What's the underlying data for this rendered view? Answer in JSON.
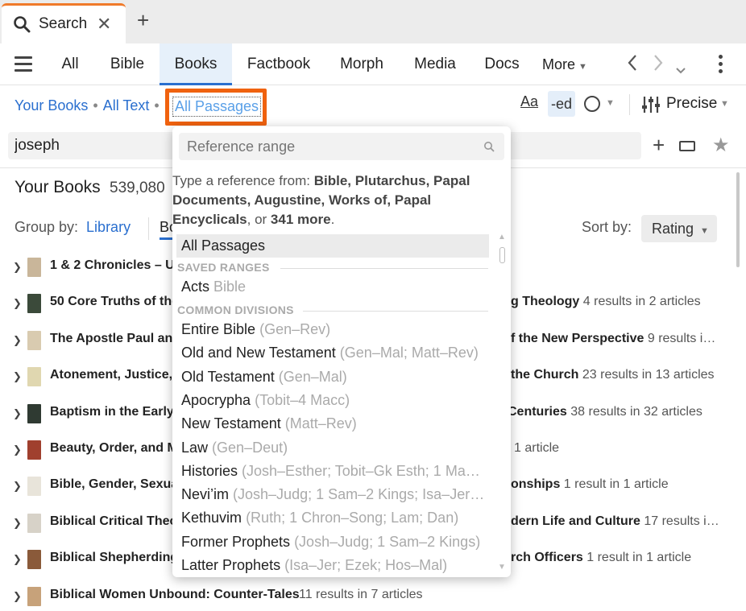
{
  "tab": {
    "label": "Search",
    "close": "✕",
    "new_tab": "+"
  },
  "nav": {
    "items": [
      "All",
      "Bible",
      "Books",
      "Factbook",
      "Morph",
      "Media",
      "Docs"
    ],
    "active": "Books",
    "more": "More"
  },
  "scope": {
    "your_books": "Your Books",
    "all_text": "All Text",
    "all_passages": "All Passages",
    "sep": "•"
  },
  "tools": {
    "aa": "Aa",
    "ed": "-ed",
    "precise": "Precise"
  },
  "search": {
    "value": "joseph"
  },
  "results": {
    "title": "Your Books",
    "count": "539,080",
    "group_by_label": "Group by:",
    "group_library": "Library",
    "group_books": "Bo",
    "sort_by_label": "Sort by:",
    "sort_value": "Rating"
  },
  "rows": [
    {
      "title": "1 & 2 Chronicles – UE",
      "right_b": "",
      "right_s": "",
      "cover": "#c9b69a"
    },
    {
      "title": "50 Core Truths of the",
      "right_b": "g Theology",
      "right_s": " 4 results in 2 articles",
      "cover": "#3b4a3a"
    },
    {
      "title": "The Apostle Paul and",
      "right_b": "f the New Perspective",
      "right_s": " 9 results i…",
      "cover": "#d9cbb0"
    },
    {
      "title": "Atonement, Justice,",
      "right_b": "the Church",
      "right_s": " 23 results in 13 articles",
      "cover": "#e0d7b0"
    },
    {
      "title": "Baptism in the Early",
      "right_b": "Centuries",
      "right_s": " 38 results in 32 articles",
      "cover": "#2f3a32"
    },
    {
      "title": "Beauty, Order, and M",
      "right_b": "",
      "right_s": "1 article",
      "cover": "#a0402e"
    },
    {
      "title": "Bible, Gender, Sexua",
      "right_b": "onships",
      "right_s": " 1 result in 1 article",
      "cover": "#e8e4da"
    },
    {
      "title": "Biblical Critical Theo",
      "right_b": "dern Life and Culture",
      "right_s": " 17 results i…",
      "cover": "#d7d2c8"
    },
    {
      "title": "Biblical Shepherding",
      "right_b": "rch Officers",
      "right_s": " 1 result in 1 article",
      "cover": "#8a5a3a"
    },
    {
      "title": "Biblical Women Unbound: Counter-Tales",
      "right_b": "",
      "right_s": "11 results in 7 articles",
      "cover": "#c7a27a"
    }
  ],
  "dropdown": {
    "placeholder": "Reference range",
    "hint_prefix": "Type a reference from: ",
    "hint_bold1": "Bible, Plutarchus, Papal Documents, Augustine, Works of, Papal Encyclicals",
    "hint_mid": ", or ",
    "hint_bold2": "341 more",
    "hint_end": ".",
    "selected": "All Passages",
    "saved_ranges_label": "SAVED RANGES",
    "saved": [
      {
        "name": "Acts",
        "sub": "Bible"
      }
    ],
    "common_label": "COMMON DIVISIONS",
    "common": [
      {
        "name": "Entire Bible",
        "sub": "(Gen–Rev)"
      },
      {
        "name": "Old and New Testament",
        "sub": "(Gen–Mal; Matt–Rev)"
      },
      {
        "name": "Old Testament",
        "sub": "(Gen–Mal)"
      },
      {
        "name": "Apocrypha",
        "sub": "(Tobit–4 Macc)"
      },
      {
        "name": "New Testament",
        "sub": "(Matt–Rev)"
      },
      {
        "name": "Law",
        "sub": "(Gen–Deut)"
      },
      {
        "name": "Histories",
        "sub": "(Josh–Esther; Tobit–Gk Esth; 1 Ma…"
      },
      {
        "name": "Nevi’im",
        "sub": "(Josh–Judg; 1 Sam–2 Kings; Isa–Jer…"
      },
      {
        "name": "Kethuvim",
        "sub": "(Ruth; 1 Chron–Song; Lam; Dan)"
      },
      {
        "name": "Former Prophets",
        "sub": "(Josh–Judg; 1 Sam–2 Kings)"
      },
      {
        "name": "Latter Prophets",
        "sub": "(Isa–Jer; Ezek; Hos–Mal)"
      }
    ]
  },
  "colors": {
    "accent": "#2a6fcf",
    "highlight": "#f0620f",
    "tab_accent": "#f07a2a"
  }
}
